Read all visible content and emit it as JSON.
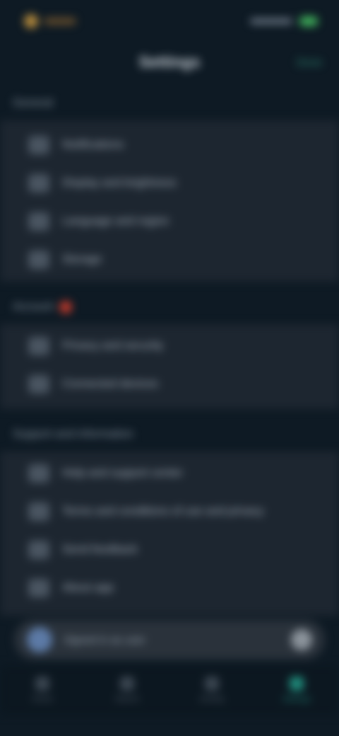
{
  "status_bar": {
    "app_name": "",
    "time": ""
  },
  "header": {
    "title": "Settings",
    "action": "Done"
  },
  "sections": [
    {
      "label": "General",
      "items": [
        {
          "label": "Notifications",
          "icon": "bell-icon"
        },
        {
          "label": "Display and brightness",
          "icon": "display-icon"
        },
        {
          "label": "Language and region",
          "icon": "globe-icon"
        },
        {
          "label": "Storage",
          "icon": "storage-icon"
        }
      ]
    },
    {
      "label": "Account",
      "badge": "",
      "items": [
        {
          "label": "Privacy and security",
          "icon": "lock-icon"
        },
        {
          "label": "Connected devices",
          "icon": "devices-icon"
        }
      ]
    },
    {
      "label": "Support and information",
      "items": [
        {
          "label": "Help and support center",
          "icon": "help-icon"
        },
        {
          "label": "Terms and conditions of use and privacy",
          "icon": "document-icon"
        },
        {
          "label": "Send feedback",
          "icon": "feedback-icon"
        },
        {
          "label": "About app",
          "icon": "info-icon"
        }
      ]
    }
  ],
  "bottom_card": {
    "text": "Signed in as user"
  },
  "tabbar": [
    {
      "label": "Home",
      "icon": "home-icon"
    },
    {
      "label": "Search",
      "icon": "search-icon"
    },
    {
      "label": "Activity",
      "icon": "activity-icon"
    },
    {
      "label": "Settings",
      "icon": "gear-icon",
      "active": true
    }
  ],
  "colors": {
    "accent": "#1f8a7a",
    "badge": "#c0392b",
    "battery": "#3fae5a"
  }
}
